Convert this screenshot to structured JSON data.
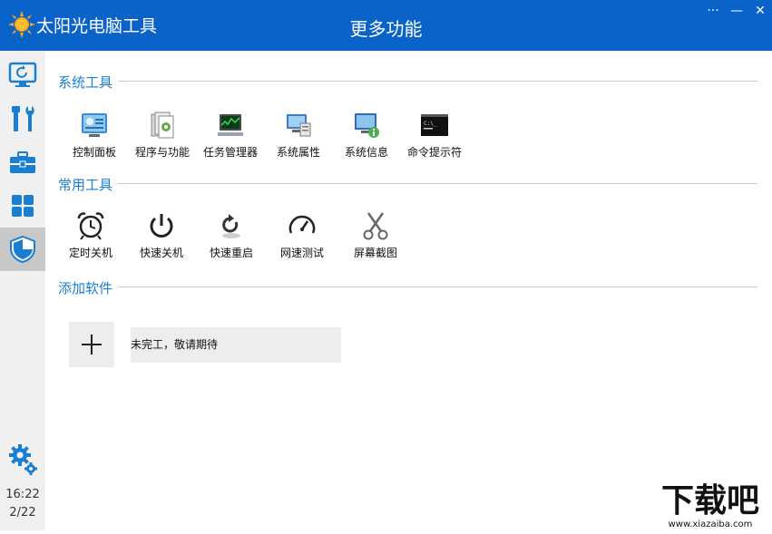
{
  "header": {
    "app_title": "太阳光电脑工具",
    "page_title": "更多功能",
    "menu_label": "···",
    "minimize_label": "—",
    "close_label": "✕"
  },
  "sidebar": {
    "items": [
      {
        "icon": "monitor-refresh-icon"
      },
      {
        "icon": "tools-icon"
      },
      {
        "icon": "toolbox-icon"
      },
      {
        "icon": "apps-grid-icon"
      },
      {
        "icon": "shield-icon",
        "active": true
      }
    ],
    "settings_icon": "gears-icon",
    "time": "16:22",
    "date": "2/22"
  },
  "sections": {
    "system_tools": {
      "title": "系统工具",
      "items": [
        "控制面板",
        "程序与功能",
        "任务管理器",
        "系统属性",
        "系统信息",
        "命令提示符"
      ]
    },
    "common_tools": {
      "title": "常用工具",
      "items": [
        "定时关机",
        "快速关机",
        "快速重启",
        "网速测试",
        "屏幕截图"
      ]
    },
    "add_software": {
      "title": "添加软件",
      "placeholder_text": "未完工，敬请期待"
    }
  },
  "watermark": {
    "logo_text": "下载吧",
    "url_text": "www.xiazaiba.com"
  },
  "colors": {
    "titlebar": "#0a63c8",
    "section_title": "#1a7fd1",
    "sidebar_bg": "#f0f0f0",
    "sidebar_active": "#c8c8c8"
  }
}
